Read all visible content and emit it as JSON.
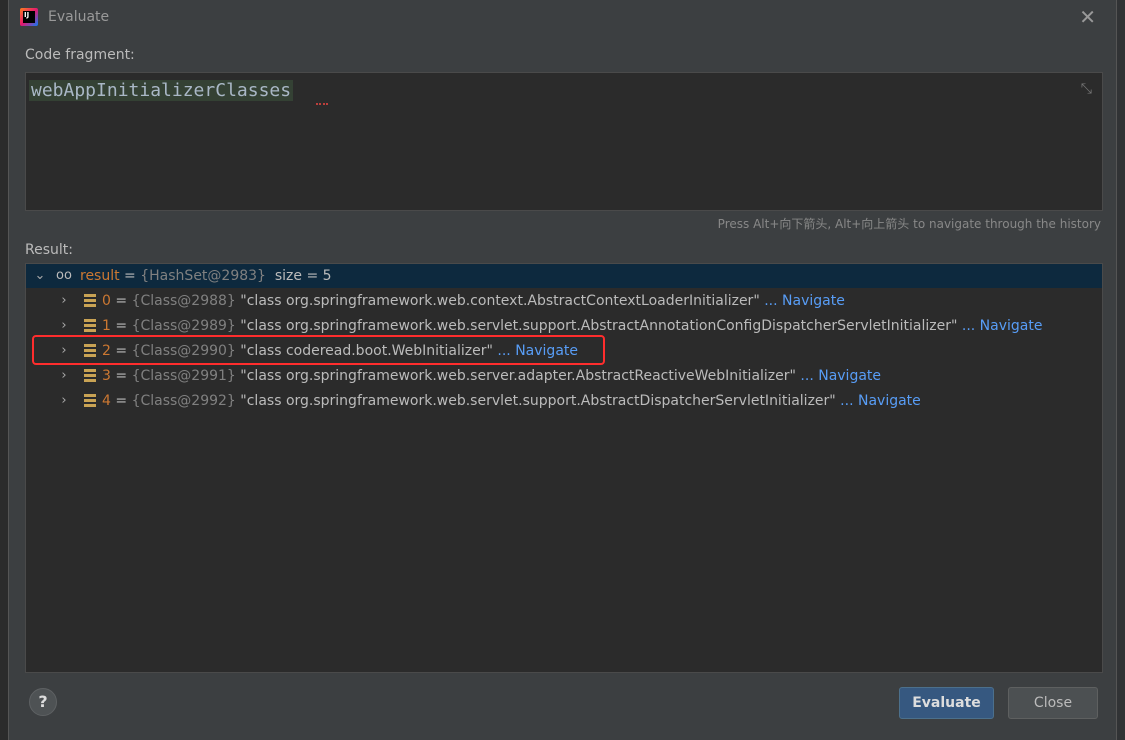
{
  "window": {
    "title": "Evaluate"
  },
  "code": {
    "label": "Code fragment:",
    "text": "webAppInitializerClasses",
    "hint": "Press Alt+向下箭头, Alt+向上箭头 to navigate through the history"
  },
  "result": {
    "label": "Result:",
    "root": {
      "name": "result",
      "eq": " = ",
      "ref": "{HashSet@2983}",
      "size": "size = 5"
    },
    "items": [
      {
        "index": "0",
        "eq": " = ",
        "ref": "{Class@2988}",
        "value": "\"class org.springframework.web.context.AbstractContextLoaderInitializer\"",
        "nav": " ... Navigate"
      },
      {
        "index": "1",
        "eq": " = ",
        "ref": "{Class@2989}",
        "value": "\"class org.springframework.web.servlet.support.AbstractAnnotationConfigDispatcherServletInitializer\"",
        "nav": " ... Navigate"
      },
      {
        "index": "2",
        "eq": " = ",
        "ref": "{Class@2990}",
        "value": "\"class coderead.boot.WebInitializer\"",
        "nav": " ... Navigate"
      },
      {
        "index": "3",
        "eq": " = ",
        "ref": "{Class@2991}",
        "value": "\"class org.springframework.web.server.adapter.AbstractReactiveWebInitializer\"",
        "nav": " ... Navigate"
      },
      {
        "index": "4",
        "eq": " = ",
        "ref": "{Class@2992}",
        "value": "\"class org.springframework.web.servlet.support.AbstractDispatcherServletInitializer\"",
        "nav": " ... Navigate"
      }
    ]
  },
  "buttons": {
    "help": "?",
    "evaluate": "Evaluate",
    "close": "Close"
  },
  "colors": {
    "accent": "#365880",
    "link": "#589df6",
    "highlight": "#ff2d2d",
    "selection": "#0d293e"
  }
}
